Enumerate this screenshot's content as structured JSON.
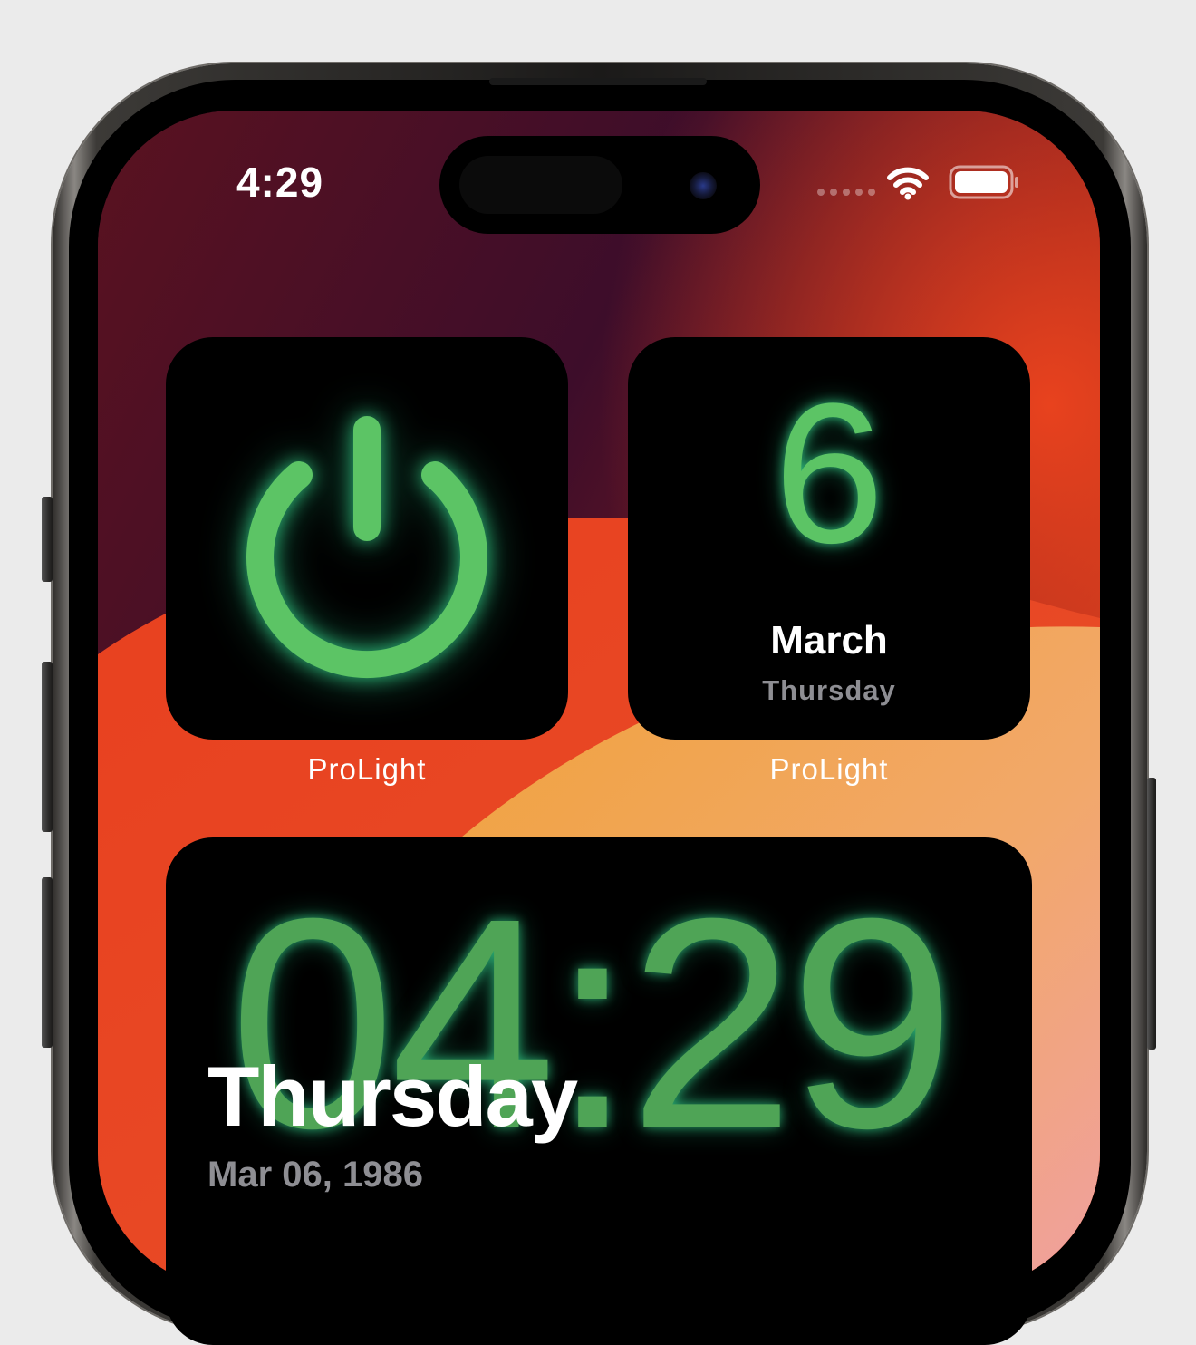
{
  "status_bar": {
    "time": "4:29",
    "signal_icon": "signal-dots-icon",
    "wifi_icon": "wifi-icon",
    "battery_icon": "battery-full-icon",
    "battery_level": 1.0
  },
  "widgets": [
    {
      "kind": "power-toggle",
      "icon": "power-icon",
      "label": "ProLight"
    },
    {
      "kind": "date",
      "day_number": "6",
      "month": "March",
      "weekday": "Thursday",
      "label": "ProLight"
    },
    {
      "kind": "clock",
      "time": "04:29",
      "weekday": "Thursday",
      "date": "Mar 06, 1986"
    }
  ],
  "colors": {
    "accent_green": "#5cc465",
    "glow": "#3ce696",
    "widget_bg": "#000000",
    "secondary_text": "#8e8e93"
  }
}
